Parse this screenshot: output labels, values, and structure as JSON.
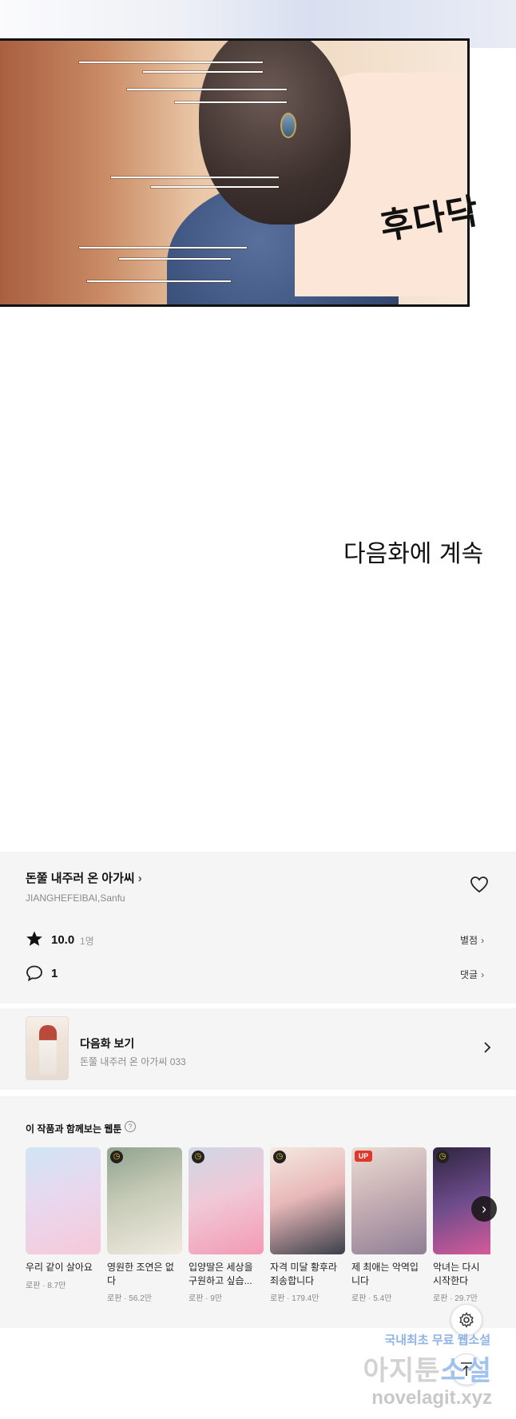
{
  "comic": {
    "sound_effect": "후다닥",
    "to_be_continued": "다음화에 계속"
  },
  "series": {
    "title": "돈쭐 내주러 온 아가씨",
    "author": "JIANGHEFEIBAI,Sanfu",
    "rating": "10.0",
    "rating_count": "1명",
    "rating_link": "별점",
    "comment_count": "1",
    "comment_link": "댓글"
  },
  "next_episode": {
    "label": "다음화 보기",
    "subtitle": "돈쭐 내주러 온 아가씨 033"
  },
  "recommendations": {
    "heading": "이 작품과 함께보는 웹툰",
    "items": [
      {
        "title": "우리 같이 살아요",
        "meta": "로판 · 8.7만",
        "badge": ""
      },
      {
        "title": "영원한 조연은 없다",
        "meta": "로판 · 56.2만",
        "badge": "clock"
      },
      {
        "title": "입양딸은 세상을 구원하고 싶습...",
        "meta": "로판 · 9만",
        "badge": "clock"
      },
      {
        "title": "자격 미달 황후라 죄송합니다",
        "meta": "로판 · 179.4만",
        "badge": "clock"
      },
      {
        "title": "제 최애는 악역입니다",
        "meta": "로판 · 5.4만",
        "badge": "UP"
      },
      {
        "title": "악녀는 다시 시작한다",
        "meta": "로판 · 29.7만",
        "badge": "clock"
      }
    ]
  },
  "watermark": {
    "line1_a": "국내최초 무료",
    "line1_b": "웹소설",
    "line2_a": "아지툰",
    "line2_b": "소설",
    "line3": "novelagit.xyz"
  },
  "icons": {
    "heart": "heart-icon",
    "star": "star-icon",
    "comment": "comment-icon",
    "settings": "gear-icon",
    "to_top": "arrow-up-icon"
  }
}
